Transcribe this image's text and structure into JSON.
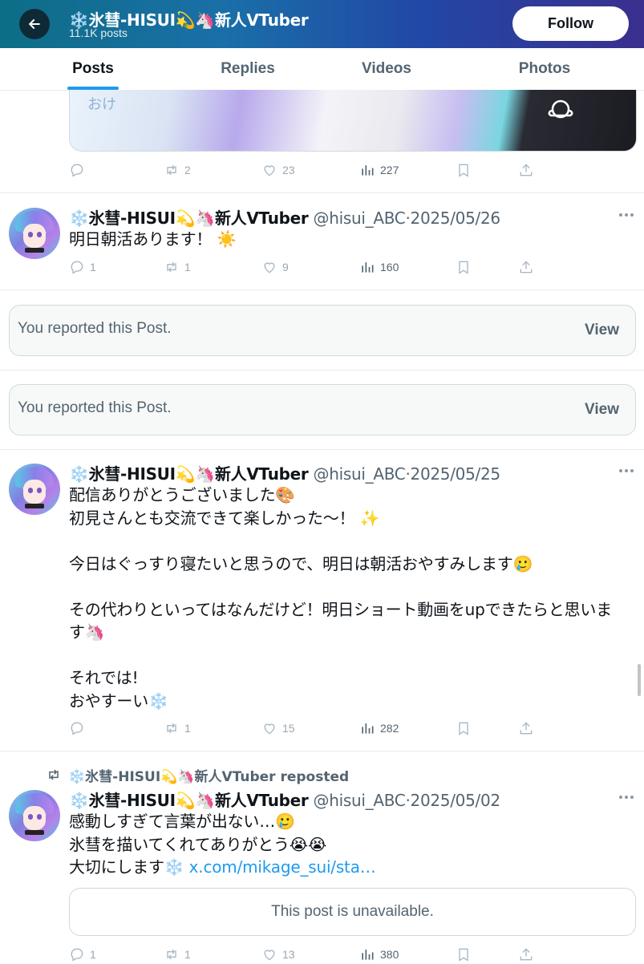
{
  "header": {
    "display_name": "❄️氷彗-HISUI💫🦄新人VTuber",
    "post_count": "11.1K posts",
    "follow_label": "Follow"
  },
  "tabs": [
    {
      "label": "Posts",
      "active": true
    },
    {
      "label": "Replies",
      "active": false
    },
    {
      "label": "Videos",
      "active": false
    },
    {
      "label": "Photos",
      "active": false
    }
  ],
  "top_media": {
    "overlay_text": "おけ"
  },
  "post0": {
    "replies": "",
    "reposts": "2",
    "likes": "23",
    "views": "227"
  },
  "post1": {
    "display_name": "❄️氷彗-HISUI💫🦄新人VTuber",
    "handle": "@hisui_ABC",
    "date": "2025/05/26",
    "text": "明日朝活あります！ ☀️",
    "replies": "1",
    "reposts": "1",
    "likes": "9",
    "views": "160"
  },
  "reported": [
    {
      "text": "You reported this Post.",
      "action": "View"
    },
    {
      "text": "You reported this Post.",
      "action": "View"
    }
  ],
  "post2": {
    "display_name": "❄️氷彗-HISUI💫🦄新人VTuber",
    "handle": "@hisui_ABC",
    "date": "2025/05/25",
    "text": "配信ありがとうございました🎨\n初見さんとも交流できて楽しかった～！ ✨\n\n今日はぐっすり寝たいと思うので、明日は朝活おやすみします🥲\n\nその代わりといってはなんだけど！明日ショート動画をupできたらと思いま\nす🦄\n\nそれでは!\nおやすーい❄️",
    "replies": "",
    "reposts": "1",
    "likes": "15",
    "views": "282"
  },
  "post3": {
    "repost_label": "❄️氷彗-HISUI💫🦄新人VTuber reposted",
    "display_name": "❄️氷彗-HISUI💫🦄新人VTuber",
    "handle": "@hisui_ABC",
    "date": "2025/05/02",
    "text_line1": "感動しすぎて言葉が出ない…🥲",
    "text_line2": "氷彗を描いてくれてありがとう😭😭",
    "text_line3": "大切にします❄️ ",
    "link": "x.com/mikage_sui/sta…",
    "unavailable": "This post is unavailable.",
    "replies": "1",
    "reposts": "1",
    "likes": "13",
    "views": "380"
  },
  "icons": {
    "back": "arrow-left-icon",
    "reply": "speech-bubble-icon",
    "repost": "repost-arrows-icon",
    "like": "heart-icon",
    "views": "bar-chart-icon",
    "bookmark": "bookmark-icon",
    "share": "share-upload-icon",
    "more": "ellipsis-icon"
  },
  "colors": {
    "accent": "#1d9bf0",
    "text": "#0f1419",
    "muted": "#536471"
  }
}
